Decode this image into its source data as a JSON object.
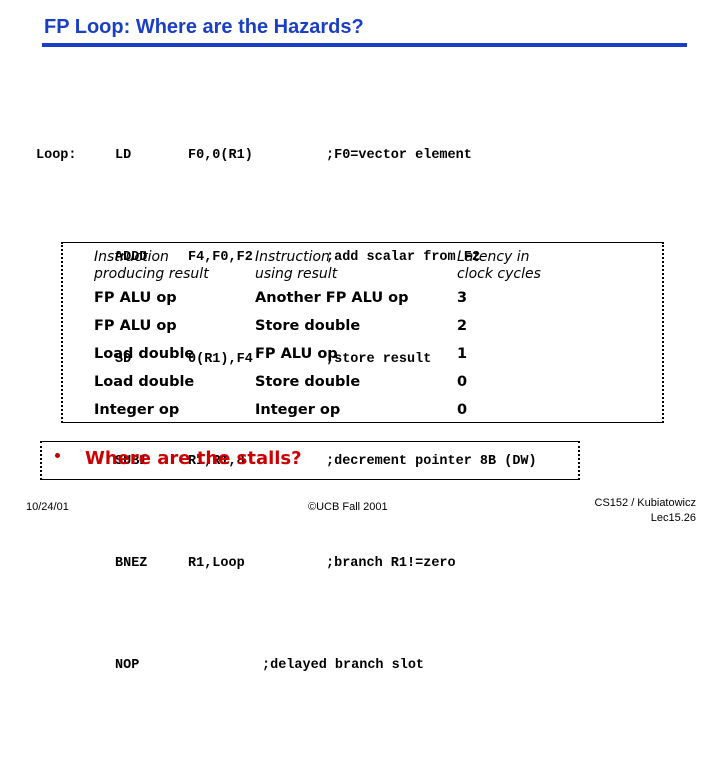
{
  "slide": {
    "title": "FP Loop: Where are the Hazards?"
  },
  "code": {
    "rows": [
      {
        "label": "Loop:",
        "op": "LD",
        "args": "F0,0(R1)",
        "comment": ";F0=vector element"
      },
      {
        "label": "",
        "op": "ADDD",
        "args": "F4,F0,F2",
        "comment": ";add scalar from F2"
      },
      {
        "label": "",
        "op": "SD",
        "args": "0(R1),F4",
        "comment": ";store result"
      },
      {
        "label": "",
        "op": "SUBI",
        "args": "R1,R1,8",
        "comment": ";decrement pointer 8B (DW)"
      },
      {
        "label": "",
        "op": "BNEZ",
        "args": "R1,Loop",
        "comment": ";branch R1!=zero"
      },
      {
        "label": "",
        "op": "NOP",
        "args": "",
        "comment": ";delayed branch slot"
      }
    ]
  },
  "latency_table": {
    "headers": [
      "Instruction\nproducing result",
      "Instruction\nusing result",
      "Latency in\nclock cycles"
    ],
    "rows": [
      {
        "producing": "FP ALU op",
        "using": "Another FP ALU op",
        "latency": "3"
      },
      {
        "producing": "FP ALU op",
        "using": "Store double",
        "latency": "2"
      },
      {
        "producing": "Load double",
        "using": "FP ALU op",
        "latency": "1"
      },
      {
        "producing": "Load double",
        "using": "Store double",
        "latency": "0"
      },
      {
        "producing": "Integer op",
        "using": "Integer op",
        "latency": "0"
      }
    ]
  },
  "stalls": {
    "bullet_text": "Where are the stalls?"
  },
  "footer": {
    "date": "10/24/01",
    "center": "©UCB Fall 2001",
    "course": "CS152 / Kubiatowicz",
    "lecture": "Lec15.26"
  },
  "colors": {
    "title_blue": "#1a3fc4",
    "stalls_red": "#cc0000",
    "text_black": "#000000"
  }
}
